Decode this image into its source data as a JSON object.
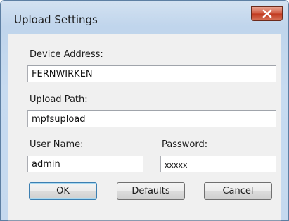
{
  "window": {
    "title": "Upload Settings"
  },
  "fields": {
    "device_address": {
      "label": "Device Address:",
      "value": "FERNWIRKEN"
    },
    "upload_path": {
      "label": "Upload Path:",
      "value": "mpfsupload"
    },
    "user_name": {
      "label": "User Name:",
      "value": "admin"
    },
    "password": {
      "label": "Password:",
      "value": "xxxxx"
    }
  },
  "buttons": {
    "ok": "OK",
    "defaults": "Defaults",
    "cancel": "Cancel"
  }
}
